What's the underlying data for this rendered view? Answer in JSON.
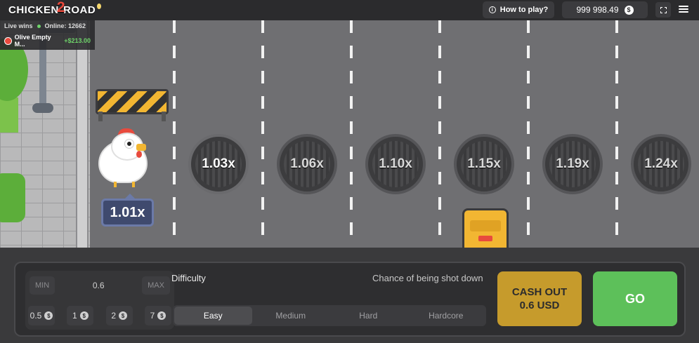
{
  "header": {
    "logo_left": "CHICKEN",
    "logo_number": "2",
    "logo_right": "ROAD",
    "how_to_play": "How to play?",
    "balance": "999 998.49",
    "currency_symbol": "$"
  },
  "live": {
    "title": "Live wins",
    "online": "Online: 12662",
    "player": "Olive Empty M...",
    "amount": "+$213.00"
  },
  "game": {
    "current_multiplier": "1.01x",
    "multipliers": [
      "1.03x",
      "1.06x",
      "1.10x",
      "1.15x",
      "1.19x",
      "1.24x"
    ]
  },
  "bet": {
    "min_label": "MIN",
    "max_label": "MAX",
    "value": "0.6",
    "chips": [
      "0.5",
      "1",
      "2",
      "7"
    ]
  },
  "difficulty": {
    "label": "Difficulty",
    "chance_label": "Chance of being shot down",
    "options": [
      "Easy",
      "Medium",
      "Hard",
      "Hardcore"
    ],
    "selected": "Easy"
  },
  "actions": {
    "cashout_line1": "CASH OUT",
    "cashout_line2": "0.6 USD",
    "go": "GO"
  },
  "colors": {
    "road": "#6f6f72",
    "cashout": "#c69b2c",
    "go": "#5dc05a",
    "win": "#6fd36a"
  },
  "icons": [
    "info-icon",
    "dollar-coin-icon",
    "fullscreen-icon",
    "menu-icon",
    "chicken-icon",
    "manhole-icon",
    "taxi-icon",
    "barrier-icon"
  ]
}
